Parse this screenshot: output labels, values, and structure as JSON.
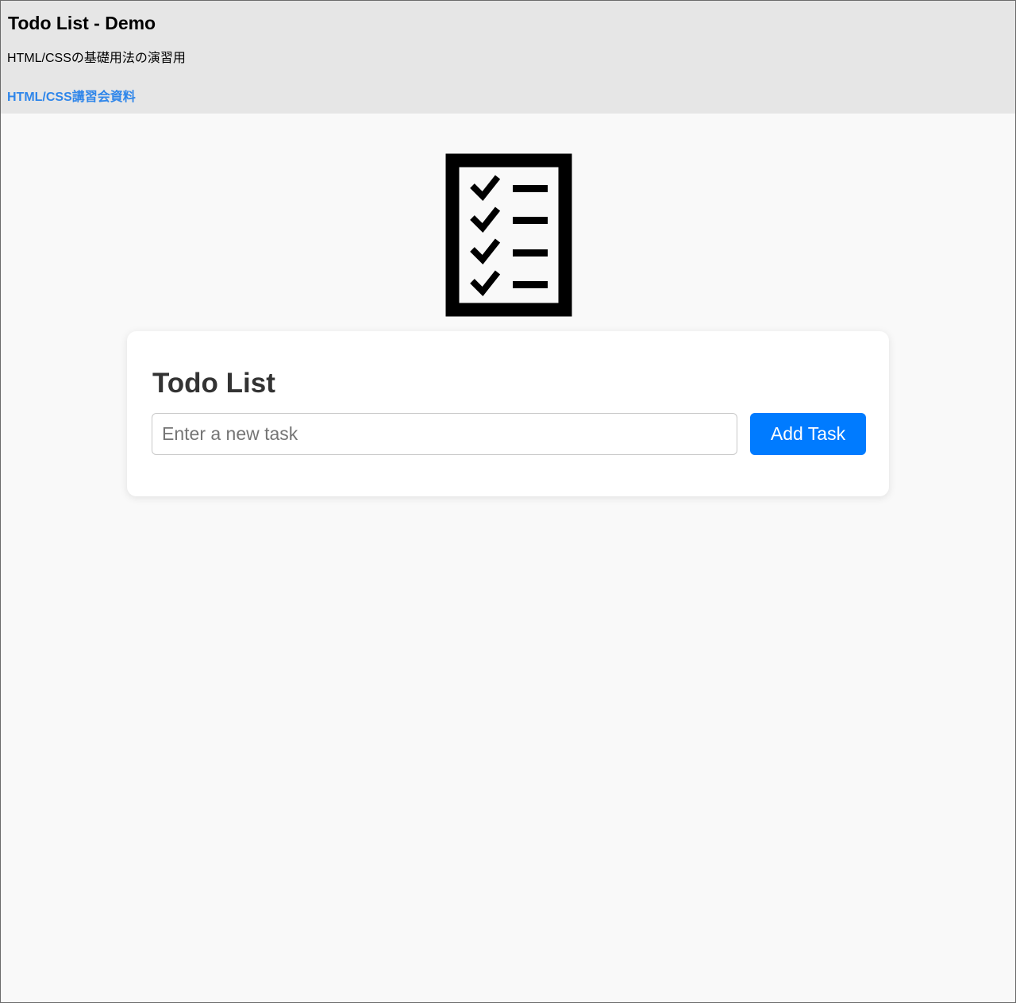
{
  "header": {
    "title": "Todo List - Demo",
    "subtitle": "HTML/CSSの基礎用法の演習用",
    "link_text": "HTML/CSS講習会資料"
  },
  "logo": {
    "icon": "checklist-icon",
    "color": "#000000"
  },
  "todo": {
    "title": "Todo List",
    "input_value": "",
    "input_placeholder": "Enter a new task",
    "add_button_label": "Add Task",
    "accent_color": "#007bff"
  }
}
